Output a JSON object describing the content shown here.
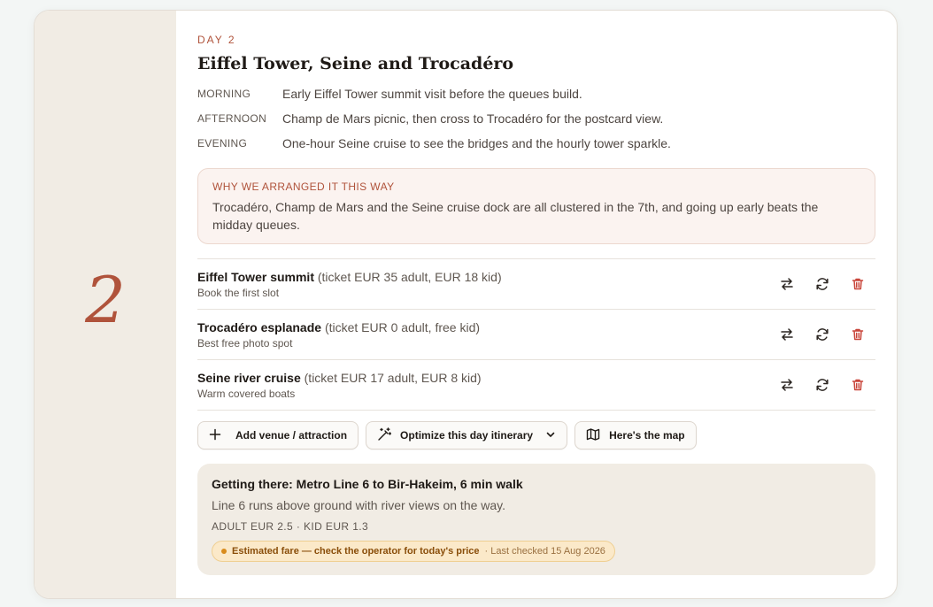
{
  "day": {
    "number": "2",
    "label": "DAY 2",
    "title": "Eiffel Tower, Seine and Trocadéro"
  },
  "slots": [
    {
      "label": "MORNING",
      "text": "Early Eiffel Tower summit visit before the queues build."
    },
    {
      "label": "AFTERNOON",
      "text": "Champ de Mars picnic, then cross to Trocadéro for the postcard view."
    },
    {
      "label": "EVENING",
      "text": "One-hour Seine cruise to see the bridges and the hourly tower sparkle."
    }
  ],
  "why": {
    "title": "WHY WE ARRANGED IT THIS WAY",
    "text": "Trocadéro, Champ de Mars and the Seine cruise dock are all clustered in the 7th, and going up early beats the midday queues."
  },
  "venues": [
    {
      "name": "Eiffel Tower summit",
      "ticket": "(ticket EUR 35 adult, EUR 18 kid)",
      "note": "Book the first slot"
    },
    {
      "name": "Trocadéro esplanade",
      "ticket": "(ticket EUR 0 adult, free kid)",
      "note": "Best free photo spot"
    },
    {
      "name": "Seine river cruise",
      "ticket": "(ticket EUR 17 adult, EUR 8 kid)",
      "note": "Warm covered boats"
    }
  ],
  "toolbar": {
    "add_label": "Add venue / attraction",
    "optimize_label": "Optimize this day itinerary",
    "map_label": "Here's the map"
  },
  "transit": {
    "title": "Getting there: Metro Line 6 to Bir-Hakeim, 6 min walk",
    "description": "Line 6 runs above ground with river views on the way.",
    "fare": "ADULT EUR 2.5 · KID EUR 1.3",
    "warning": "Estimated fare — check the operator for today's price",
    "checked": "· Last checked 15 Aug 2026"
  },
  "colors": {
    "accent": "#b0533b",
    "rail_bg": "#f1ece4",
    "why_bg": "#fbf3f0",
    "trash": "#c9453a",
    "badge_bg": "#fbe9c9"
  },
  "icons": {
    "swap": "swap-icon",
    "refresh": "refresh-icon",
    "trash": "trash-icon",
    "plus": "plus-icon",
    "wand": "magic-wand-icon",
    "chevron": "chevron-down-icon",
    "map": "map-icon"
  }
}
